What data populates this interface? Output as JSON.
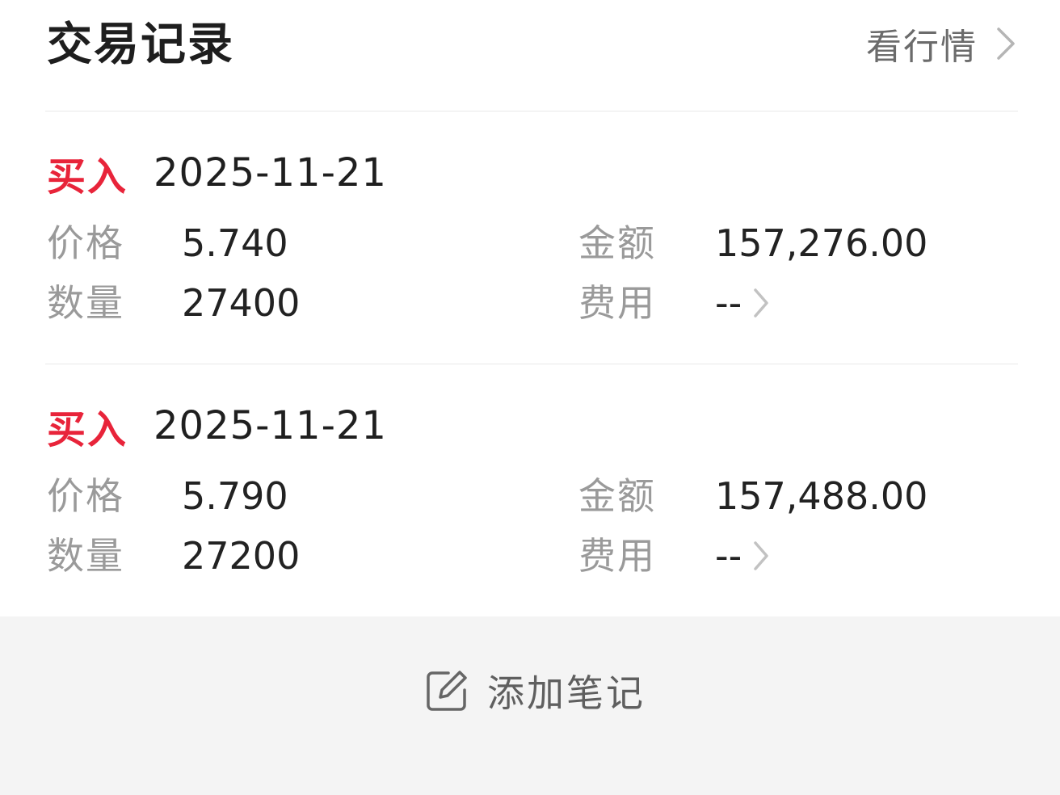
{
  "header": {
    "title": "交易记录",
    "market_link_label": "看行情"
  },
  "records": [
    {
      "type": "买入",
      "date": "2025-11-21",
      "price_label": "价格",
      "price": "5.740",
      "amount_label": "金额",
      "amount": "157,276.00",
      "quantity_label": "数量",
      "quantity": "27400",
      "fee_label": "费用",
      "fee": "--"
    },
    {
      "type": "买入",
      "date": "2025-11-21",
      "price_label": "价格",
      "price": "5.790",
      "amount_label": "金额",
      "amount": "157,488.00",
      "quantity_label": "数量",
      "quantity": "27200",
      "fee_label": "费用",
      "fee": "--"
    }
  ],
  "footer": {
    "add_note_label": "添加笔记",
    "add_note_icon": "edit-note-icon"
  },
  "colors": {
    "buy": "#e8243a",
    "label_gray": "#9a9a9a",
    "footer_bg": "#f4f4f4"
  }
}
